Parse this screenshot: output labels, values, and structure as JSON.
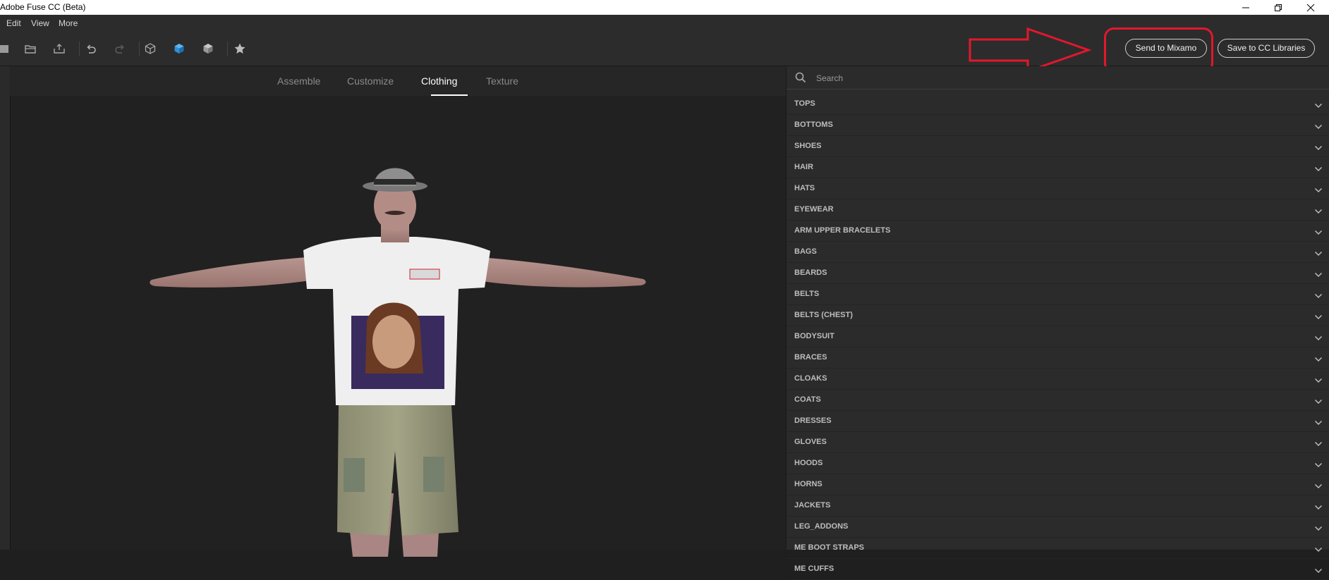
{
  "window": {
    "title": "Adobe Fuse CC (Beta)"
  },
  "menu": [
    "Edit",
    "View",
    "More"
  ],
  "toolbar": {
    "send_label": "Send to Mixamo",
    "save_label": "Save to CC Libraries"
  },
  "tabs": [
    {
      "label": "Assemble",
      "active": false
    },
    {
      "label": "Customize",
      "active": false
    },
    {
      "label": "Clothing",
      "active": true
    },
    {
      "label": "Texture",
      "active": false
    }
  ],
  "search": {
    "placeholder": "Search"
  },
  "categories": [
    "TOPS",
    "BOTTOMS",
    "SHOES",
    "HAIR",
    "HATS",
    "EYEWEAR",
    "ARM UPPER BRACELETS",
    "BAGS",
    "BEARDS",
    "BELTS",
    "BELTS (CHEST)",
    "BODYSUIT",
    "BRACES",
    "CLOAKS",
    "COATS",
    "DRESSES",
    "GLOVES",
    "HOODS",
    "HORNS",
    "JACKETS",
    "LEG_ADDONS",
    "ME BOOT STRAPS",
    "ME CUFFS"
  ],
  "colors": {
    "annotation": "#e3172c",
    "accent_blue": "#2f8fd8"
  },
  "icons": {
    "window_controls": [
      "minimize-icon",
      "restore-icon",
      "close-icon"
    ],
    "tools": [
      "new-file-icon",
      "open-folder-icon",
      "export-icon",
      "undo-icon",
      "redo-icon",
      "wireframe-cube-icon",
      "solid-cube-icon",
      "shaded-cube-icon",
      "star-icon"
    ]
  }
}
